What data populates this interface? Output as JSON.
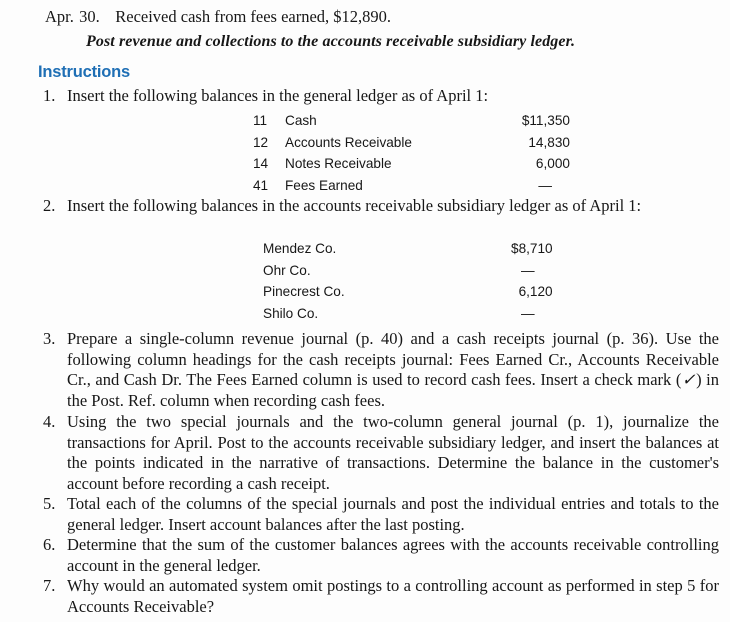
{
  "transaction": {
    "month": "Apr.",
    "day": "30.",
    "description": "Received cash from fees earned, $12,890.",
    "note": "Post revenue and collections to the accounts receivable subsidiary ledger."
  },
  "instructions": {
    "heading": "Instructions",
    "items": [
      {
        "number": "1.",
        "text": "Insert the following balances in the general ledger as of April 1:"
      },
      {
        "number": "2.",
        "text": "Insert the following balances in the accounts receivable subsidiary ledger as of April 1:"
      },
      {
        "number": "3.",
        "text_before_check": "Prepare a single-column revenue journal (p. 40) and a cash receipts journal (p. 36). Use the following column headings for the cash receipts journal: Fees Earned Cr., Accounts Receivable Cr., and Cash Dr. The Fees Earned column is used to record cash fees. Insert a check mark (",
        "check_glyph": "✓",
        "text_after_check": ") in the Post. Ref. column when recording cash fees."
      },
      {
        "number": "4.",
        "text": "Using the two special journals and the two-column general journal (p. 1), journalize the transactions for April. Post to the accounts receivable subsidiary ledger, and insert the balances at the points indicated in the narrative of transactions. Determine the balance in the customer's account before recording a cash receipt."
      },
      {
        "number": "5.",
        "text": "Total each of the columns of the special journals and post the individual entries and totals to the general ledger. Insert account balances after the last posting."
      },
      {
        "number": "6.",
        "text": "Determine that the sum of the customer balances agrees with the accounts receivable controlling account in the general ledger."
      },
      {
        "number": "7.",
        "text": "Why would an automated system omit postings to a controlling account as performed in step 5 for Accounts Receivable?"
      }
    ]
  },
  "general_ledger": {
    "rows": [
      {
        "account_no": "11",
        "name": "Cash",
        "amount": "$11,350"
      },
      {
        "account_no": "12",
        "name": "Accounts Receivable",
        "amount": "14,830"
      },
      {
        "account_no": "14",
        "name": "Notes Receivable",
        "amount": "6,000"
      },
      {
        "account_no": "41",
        "name": "Fees Earned",
        "amount": "—"
      }
    ]
  },
  "subsidiary_ledger": {
    "rows": [
      {
        "name": "Mendez Co.",
        "amount": "$8,710"
      },
      {
        "name": "Ohr Co.",
        "amount": "—"
      },
      {
        "name": "Pinecrest Co.",
        "amount": "6,120"
      },
      {
        "name": "Shilo Co.",
        "amount": "—"
      }
    ]
  },
  "colors": {
    "heading_blue": "#1f6fb5",
    "body_text": "#171717",
    "page_background": "#fdfdfd"
  }
}
